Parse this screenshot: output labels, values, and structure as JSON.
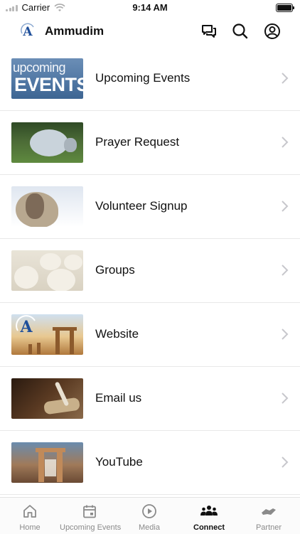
{
  "status_bar": {
    "carrier": "Carrier",
    "time": "9:14 AM"
  },
  "header": {
    "title": "Ammudim",
    "logo_letter": "A"
  },
  "list": {
    "items": [
      {
        "label": "Upcoming Events",
        "thumb_text_top": "upcoming",
        "thumb_text_bottom": "EVENTS"
      },
      {
        "label": "Prayer Request"
      },
      {
        "label": "Volunteer Signup"
      },
      {
        "label": "Groups"
      },
      {
        "label": "Website",
        "thumb_text": "A"
      },
      {
        "label": "Email us"
      },
      {
        "label": "YouTube"
      }
    ]
  },
  "tabbar": {
    "tabs": [
      {
        "label": "Home",
        "icon": "home-icon",
        "active": false
      },
      {
        "label": "Upcoming Events",
        "icon": "calendar-icon",
        "active": false
      },
      {
        "label": "Media",
        "icon": "play-circle-icon",
        "active": false
      },
      {
        "label": "Connect",
        "icon": "people-icon",
        "active": true
      },
      {
        "label": "Partner",
        "icon": "handshake-icon",
        "active": false
      }
    ]
  },
  "colors": {
    "accent": "#111111",
    "inactive": "#8a8a8a",
    "logo_blue": "#1f4f9a"
  }
}
